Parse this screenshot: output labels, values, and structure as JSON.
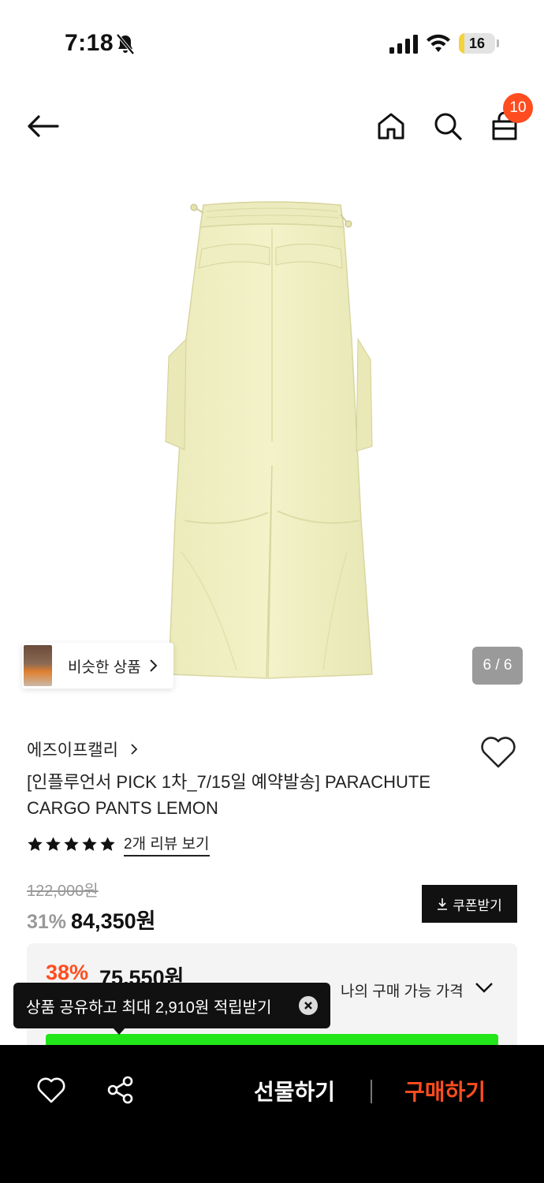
{
  "status_bar": {
    "time": "7:18",
    "battery": "16",
    "battery_level": 0.16
  },
  "nav": {
    "cart_count": "10"
  },
  "gallery": {
    "similar_label": "비슷한 상품",
    "page_indicator": "6 / 6"
  },
  "product": {
    "brand": "에즈이프캘리",
    "title": "[인플루언서 PICK 1차_7/15일 예약발송] PARACHUTE CARGO PANTS LEMON",
    "rating_stars": 5,
    "review_link": "2개 리뷰 보기",
    "original_price": "122,000원",
    "discount": "31%",
    "price": "84,350원",
    "coupon_label": "쿠폰받기"
  },
  "my_price": {
    "discount": "38%",
    "price": "75,550원",
    "label": "나의 구매 가능 가격"
  },
  "tooltip": {
    "text": "상품 공유하고 최대 2,910원 적립받기"
  },
  "bottom_bar": {
    "gift_label": "선물하기",
    "buy_label": "구매하기"
  },
  "colors": {
    "accent": "#ff4d1f",
    "pants": "#f1f0c4",
    "green_bar": "#22e51a"
  },
  "icons": [
    "bell-off-icon",
    "signal-icon",
    "wifi-icon",
    "back-arrow-icon",
    "home-icon",
    "search-icon",
    "cart-icon",
    "chevron-right-icon",
    "heart-icon",
    "star-icon",
    "download-icon",
    "chevron-down-icon",
    "close-icon",
    "share-icon"
  ]
}
